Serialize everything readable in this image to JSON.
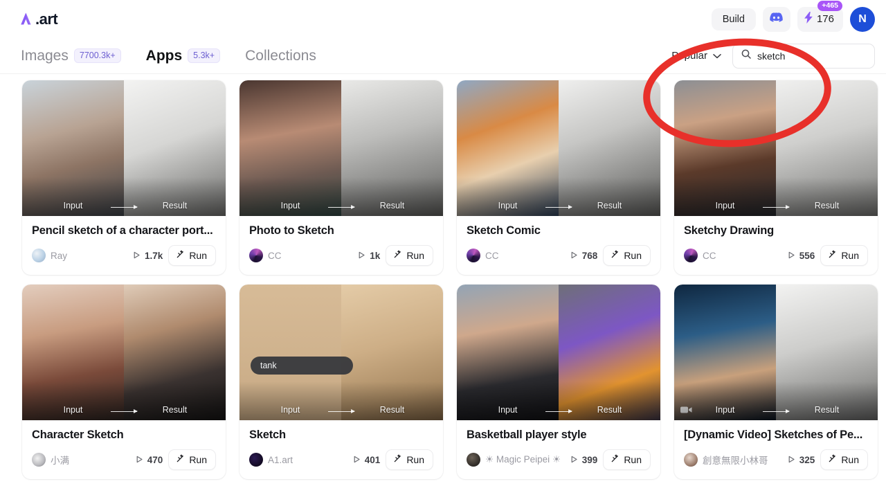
{
  "header": {
    "logo_text": ".art",
    "logo_icon": "a1-art-logo-icon",
    "build_label": "Build",
    "discord_icon": "discord-icon",
    "credits_icon": "lightning-bolt-icon",
    "credits_count": "176",
    "credits_badge": "+465",
    "avatar_initial": "N",
    "avatar_color": "#1d4ed8",
    "badge_color": "#a855f7"
  },
  "nav": {
    "tabs": [
      {
        "label": "Images",
        "count": "7700.3k+",
        "active": false
      },
      {
        "label": "Apps",
        "count": "5.3k+",
        "active": true
      },
      {
        "label": "Collections",
        "count": "",
        "active": false
      }
    ],
    "sort": {
      "label": "Popular",
      "icon": "chevron-down-icon"
    },
    "search": {
      "value": "sketch",
      "placeholder": "Search",
      "icon": "search-icon"
    }
  },
  "media_labels": {
    "input": "Input",
    "result": "Result"
  },
  "run_label": "Run",
  "cards": [
    {
      "title": "Pencil sketch of a character port...",
      "author": "Ray",
      "runs": "1.7k",
      "input_kind": "photo-portrait-man-glasses",
      "result_kind": "pencil-sketch-man-glasses",
      "prompt": "",
      "video": false
    },
    {
      "title": "Photo to Sketch",
      "author": "CC",
      "runs": "1k",
      "input_kind": "photo-portrait-curly-woman",
      "result_kind": "pencil-sketch-curly-woman",
      "prompt": "",
      "video": false
    },
    {
      "title": "Sketch Comic",
      "author": "CC",
      "runs": "768",
      "input_kind": "anime-girl-subway-color",
      "result_kind": "manga-girl-subway-bw",
      "prompt": "",
      "video": false
    },
    {
      "title": "Sketchy Drawing",
      "author": "CC",
      "runs": "556",
      "input_kind": "photo-portrait-mr-bean",
      "result_kind": "pencil-sketch-mr-bean",
      "prompt": "",
      "video": false
    },
    {
      "title": "Character Sketch",
      "author": "小满",
      "runs": "470",
      "input_kind": "photo-woman-red-lips",
      "result_kind": "illustration-woman-black-dress",
      "prompt": "",
      "video": false
    },
    {
      "title": "Sketch",
      "author": "A1.art",
      "runs": "401",
      "input_kind": "blank-tan-canvas",
      "result_kind": "pencil-sketch-tank",
      "prompt": "tank",
      "video": false
    },
    {
      "title": "Basketball player style",
      "author": "☀ Magic Peipei ☀",
      "runs": "399",
      "input_kind": "photo-young-man-suit",
      "result_kind": "basketball-player-jersey",
      "prompt": "",
      "video": false
    },
    {
      "title": "[Dynamic Video] Sketches of Pe...",
      "author": "創意無限小林哥",
      "runs": "325",
      "input_kind": "photo-man-dark-blue",
      "result_kind": "pencil-sketch-man-grey",
      "prompt": "",
      "video": true
    }
  ],
  "annotation": {
    "shape": "red-ellipse-highlight",
    "color": "#e8302a"
  }
}
